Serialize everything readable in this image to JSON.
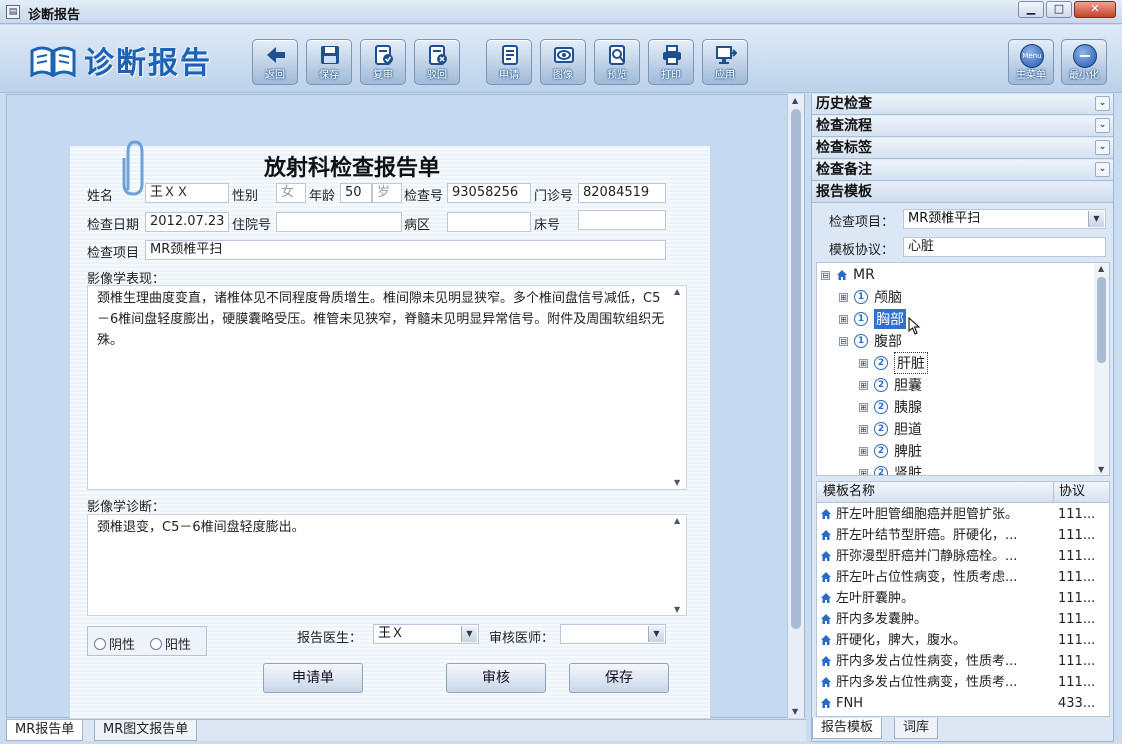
{
  "window": {
    "title": "诊断报告",
    "min": "▁",
    "max": "□",
    "close": "✕"
  },
  "toolbar": {
    "logo_text": "诊断报告",
    "buttons": [
      {
        "label": "返回",
        "icon": "back-arrow-icon"
      },
      {
        "label": "保存",
        "icon": "save-disk-icon"
      },
      {
        "label": "复审",
        "icon": "review-doc-icon"
      },
      {
        "label": "驳回",
        "icon": "reject-doc-icon"
      },
      {
        "label": "申请",
        "icon": "application-doc-icon"
      },
      {
        "label": "图像",
        "icon": "image-eye-icon"
      },
      {
        "label": "预览",
        "icon": "preview-search-icon"
      },
      {
        "label": "打印",
        "icon": "printer-icon"
      },
      {
        "label": "应用",
        "icon": "apply-monitor-icon"
      }
    ],
    "menu_badge": "Menu",
    "main_menu": "主菜单",
    "minimize": "最小化"
  },
  "report": {
    "title": "放射科检查报告单",
    "labels": {
      "name": "姓名",
      "gender": "性别",
      "age": "年龄",
      "exam_no": "检查号",
      "clinic_no": "门诊号",
      "exam_date": "检查日期",
      "inpatient_no": "住院号",
      "ward": "病区",
      "bed_no": "床号",
      "exam_item": "检查项目",
      "findings": "影像学表现：",
      "diagnosis": "影像学诊断：",
      "report_doctor": "报告医生：",
      "review_doctor": "审核医师："
    },
    "values": {
      "name": "王ＸＸ",
      "gender": "女",
      "age": "50",
      "age_unit": "岁",
      "exam_no": "93058256",
      "clinic_no": "82084519",
      "exam_date": "2012.07.23",
      "inpatient_no": "",
      "ward": "",
      "bed_no": "",
      "exam_item": "MR颈椎平扫",
      "findings": "颈椎生理曲度变直，诸椎体见不同程度骨质增生。椎间隙未见明显狭窄。多个椎间盘信号减低，C5－6椎间盘轻度膨出，硬膜囊略受压。椎管未见狭窄，脊髓未见明显异常信号。附件及周围软组织无殊。",
      "diagnosis": "颈椎退变，C5－6椎间盘轻度膨出。",
      "report_doctor": "王Ｘ",
      "review_doctor": ""
    },
    "radio": {
      "negative": "阴性",
      "positive": "阳性"
    },
    "buttons": {
      "request": "申请单",
      "review": "审核",
      "save": "保存"
    }
  },
  "bottom_tabs": [
    "MR报告单",
    "MR图文报告单"
  ],
  "right": {
    "sections": [
      "历史检查",
      "检查流程",
      "检查标签",
      "检查备注",
      "报告模板"
    ],
    "exam_item_label": "检查项目：",
    "exam_item_value": "MR颈椎平扫",
    "template_protocol_label": "模板协议：",
    "template_protocol_value": "心脏",
    "tree": [
      {
        "text": "MR",
        "level": 0,
        "exp": "⊟",
        "kind": "home"
      },
      {
        "text": "颅脑",
        "level": 1,
        "exp": "⊞",
        "num": "1"
      },
      {
        "text": "胸部",
        "level": 1,
        "exp": "⊞",
        "num": "1",
        "selected": true
      },
      {
        "text": "腹部",
        "level": 1,
        "exp": "⊟",
        "num": "1"
      },
      {
        "text": "肝脏",
        "level": 2,
        "exp": "⊞",
        "num": "2",
        "focused": true
      },
      {
        "text": "胆囊",
        "level": 2,
        "exp": "⊞",
        "num": "2"
      },
      {
        "text": "胰腺",
        "level": 2,
        "exp": "⊞",
        "num": "2"
      },
      {
        "text": "胆道",
        "level": 2,
        "exp": "⊞",
        "num": "2"
      },
      {
        "text": "脾脏",
        "level": 2,
        "exp": "⊞",
        "num": "2"
      },
      {
        "text": "肾脏",
        "level": 2,
        "exp": "⊞",
        "num": "2"
      }
    ],
    "table": {
      "headers": [
        "模板名称",
        "协议"
      ],
      "rows": [
        [
          "肝左叶胆管细胞癌并胆管扩张。",
          "111..."
        ],
        [
          "肝左叶结节型肝癌。肝硬化，...",
          "111..."
        ],
        [
          "肝弥漫型肝癌并门静脉癌栓。...",
          "111..."
        ],
        [
          "肝左叶占位性病变，性质考虑...",
          "111..."
        ],
        [
          "左叶肝囊肿。",
          "111..."
        ],
        [
          "肝内多发囊肿。",
          "111..."
        ],
        [
          "肝硬化，脾大，腹水。",
          "111..."
        ],
        [
          "肝内多发占位性病变，性质考...",
          "111..."
        ],
        [
          "肝内多发占位性病变，性质考...",
          "111..."
        ],
        [
          "FNH",
          "433..."
        ]
      ]
    },
    "bottom_tabs": [
      "报告模板",
      "词库"
    ]
  }
}
